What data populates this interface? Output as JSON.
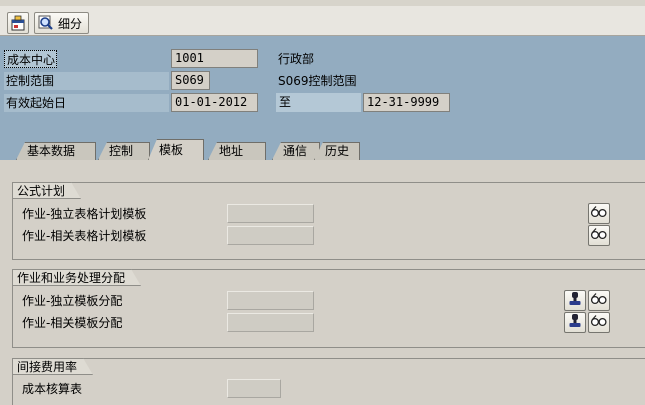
{
  "toolbar": {
    "detail_label": "细分"
  },
  "header": {
    "cost_center_label": "成本中心",
    "cost_center_value": "1001",
    "cost_center_desc": "行政部",
    "controlling_area_label": "控制范围",
    "controlling_area_value": "S069",
    "controlling_area_desc": "S069控制范围",
    "valid_from_label": "有效起始日",
    "valid_from_value": "01-01-2012",
    "to_label": "至",
    "valid_to_value": "12-31-9999"
  },
  "tabs": [
    {
      "label": "基本数据",
      "active": false
    },
    {
      "label": "控制",
      "active": false
    },
    {
      "label": "模板",
      "active": true
    },
    {
      "label": "地址",
      "active": false
    },
    {
      "label": "通信",
      "active": false
    },
    {
      "label": "历史",
      "active": false
    }
  ],
  "groups": {
    "formula_planning": {
      "title": "公式计划",
      "rows": [
        {
          "label": "作业-独立表格计划模板",
          "value": ""
        },
        {
          "label": "作业-相关表格计划模板",
          "value": ""
        }
      ]
    },
    "activity_process": {
      "title": "作业和业务处理分配",
      "rows": [
        {
          "label": "作业-独立模板分配",
          "value": ""
        },
        {
          "label": "作业-相关模板分配",
          "value": ""
        }
      ]
    },
    "overhead": {
      "title": "间接费用率",
      "rows": [
        {
          "label": "成本核算表",
          "value": ""
        }
      ]
    }
  },
  "icons": {
    "display": "glasses-icon",
    "assign": "stamp-icon",
    "toolbar_layout": "layout-icon",
    "toolbar_detail": "magnifier-icon"
  }
}
